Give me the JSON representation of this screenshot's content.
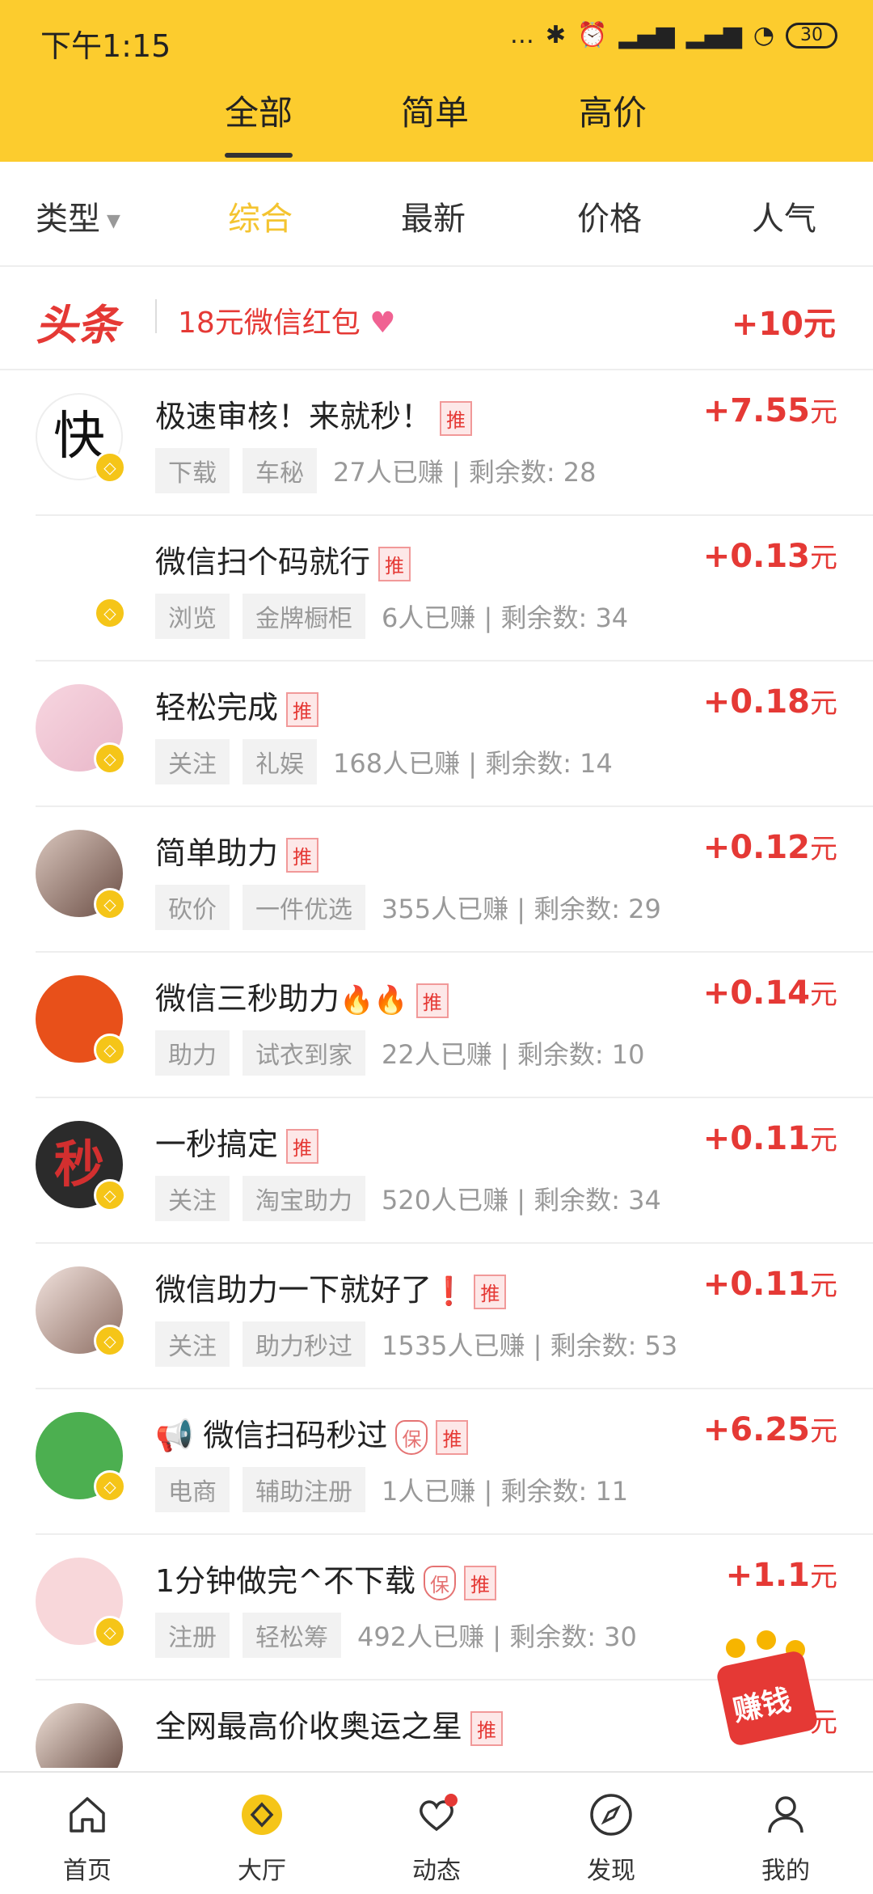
{
  "status": {
    "time": "下午1:15",
    "battery": "30"
  },
  "top_tabs": [
    "全部",
    "简单",
    "高价"
  ],
  "sort_bar": {
    "type_label": "类型",
    "options": [
      "综合",
      "最新",
      "价格",
      "人气"
    ]
  },
  "headline": {
    "logo": "头条",
    "text": "18元微信红包",
    "reward": "+10元"
  },
  "tasks": [
    {
      "title": "极速审核！来就秒！",
      "reward": "+7.55",
      "unit": "元",
      "tags": [
        "下载",
        "车秘"
      ],
      "stats": "27人已赚 | 剩余数: 28"
    },
    {
      "title": "微信扫个码就行",
      "reward": "+0.13",
      "unit": "元",
      "tags": [
        "浏览",
        "金牌橱柜"
      ],
      "stats": "6人已赚 | 剩余数: 34"
    },
    {
      "title": "轻松完成",
      "reward": "+0.18",
      "unit": "元",
      "tags": [
        "关注",
        "礼娱"
      ],
      "stats": "168人已赚 | 剩余数: 14"
    },
    {
      "title": "简单助力",
      "reward": "+0.12",
      "unit": "元",
      "tags": [
        "砍价",
        "一件优选"
      ],
      "stats": "355人已赚 | 剩余数: 29"
    },
    {
      "title": "微信三秒助力",
      "reward": "+0.14",
      "unit": "元",
      "tags": [
        "助力",
        "试衣到家"
      ],
      "stats": "22人已赚 | 剩余数: 10"
    },
    {
      "title": "一秒搞定",
      "reward": "+0.11",
      "unit": "元",
      "tags": [
        "关注",
        "淘宝助力"
      ],
      "stats": "520人已赚 | 剩余数: 34"
    },
    {
      "title": "微信助力一下就好了",
      "reward": "+0.11",
      "unit": "元",
      "tags": [
        "关注",
        "助力秒过"
      ],
      "stats": "1535人已赚 | 剩余数: 53"
    },
    {
      "title": "微信扫码秒过",
      "reward": "+6.25",
      "unit": "元",
      "tags": [
        "电商",
        "辅助注册"
      ],
      "stats": "1人已赚 | 剩余数: 11"
    },
    {
      "title": "1分钟做完^不下载",
      "reward": "+1.1",
      "unit": "元",
      "tags": [
        "注册",
        "轻松筹"
      ],
      "stats": "492人已赚 | 剩余数: 30"
    },
    {
      "title": "全网最高价收奥运之星",
      "reward": "+",
      "unit": "元",
      "tags": [],
      "stats": ""
    }
  ],
  "labels": {
    "tui": "推",
    "bao": "保",
    "avatar_kuai": "快",
    "avatar_miao": "秒",
    "badge": "◇"
  },
  "float_badge": "赚钱",
  "tabbar": [
    "首页",
    "大厅",
    "动态",
    "发现",
    "我的"
  ],
  "colors": {
    "brand_yellow": "#fccc2e",
    "reward_red": "#e53935"
  }
}
